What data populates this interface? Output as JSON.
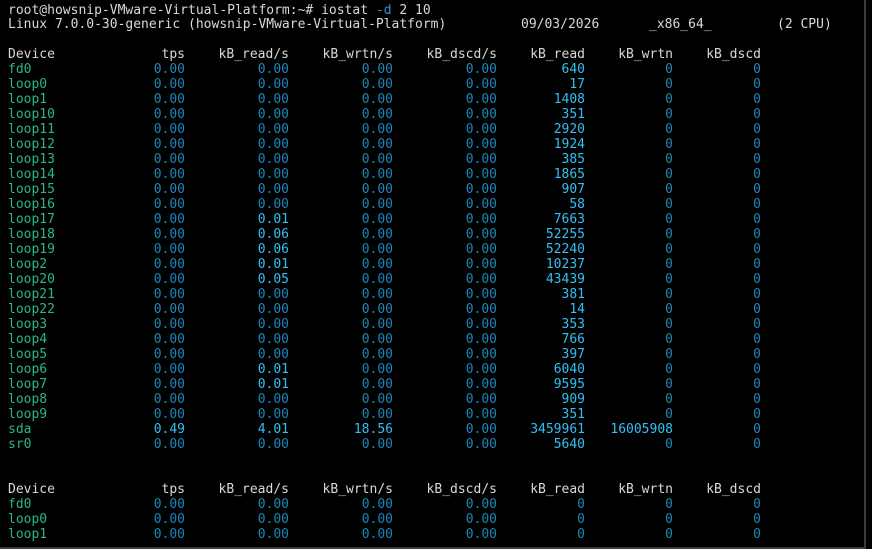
{
  "prompt": {
    "user_host": "root@howsnip-VMware-Virtual-Platform:~#",
    "command": "iostat",
    "flag": "-d",
    "args": "2 10"
  },
  "sysinfo": {
    "kernel": "Linux 7.0.0-30-generic (howsnip-VMware-Virtual-Platform)",
    "date": "09/03/2026",
    "arch": "_x86_64_",
    "cpus": "(2 CPU)"
  },
  "columns": [
    "Device",
    "tps",
    "kB_read/s",
    "kB_wrtn/s",
    "kB_dscd/s",
    "kB_read",
    "kB_wrtn",
    "kB_dscd"
  ],
  "report1": [
    [
      "fd0",
      "0.00",
      "0.00",
      "0.00",
      "0.00",
      "640",
      "0",
      "0"
    ],
    [
      "loop0",
      "0.00",
      "0.00",
      "0.00",
      "0.00",
      "17",
      "0",
      "0"
    ],
    [
      "loop1",
      "0.00",
      "0.00",
      "0.00",
      "0.00",
      "1408",
      "0",
      "0"
    ],
    [
      "loop10",
      "0.00",
      "0.00",
      "0.00",
      "0.00",
      "351",
      "0",
      "0"
    ],
    [
      "loop11",
      "0.00",
      "0.00",
      "0.00",
      "0.00",
      "2920",
      "0",
      "0"
    ],
    [
      "loop12",
      "0.00",
      "0.00",
      "0.00",
      "0.00",
      "1924",
      "0",
      "0"
    ],
    [
      "loop13",
      "0.00",
      "0.00",
      "0.00",
      "0.00",
      "385",
      "0",
      "0"
    ],
    [
      "loop14",
      "0.00",
      "0.00",
      "0.00",
      "0.00",
      "1865",
      "0",
      "0"
    ],
    [
      "loop15",
      "0.00",
      "0.00",
      "0.00",
      "0.00",
      "907",
      "0",
      "0"
    ],
    [
      "loop16",
      "0.00",
      "0.00",
      "0.00",
      "0.00",
      "58",
      "0",
      "0"
    ],
    [
      "loop17",
      "0.00",
      "0.01",
      "0.00",
      "0.00",
      "7663",
      "0",
      "0"
    ],
    [
      "loop18",
      "0.00",
      "0.06",
      "0.00",
      "0.00",
      "52255",
      "0",
      "0"
    ],
    [
      "loop19",
      "0.00",
      "0.06",
      "0.00",
      "0.00",
      "52240",
      "0",
      "0"
    ],
    [
      "loop2",
      "0.00",
      "0.01",
      "0.00",
      "0.00",
      "10237",
      "0",
      "0"
    ],
    [
      "loop20",
      "0.00",
      "0.05",
      "0.00",
      "0.00",
      "43439",
      "0",
      "0"
    ],
    [
      "loop21",
      "0.00",
      "0.00",
      "0.00",
      "0.00",
      "381",
      "0",
      "0"
    ],
    [
      "loop22",
      "0.00",
      "0.00",
      "0.00",
      "0.00",
      "14",
      "0",
      "0"
    ],
    [
      "loop3",
      "0.00",
      "0.00",
      "0.00",
      "0.00",
      "353",
      "0",
      "0"
    ],
    [
      "loop4",
      "0.00",
      "0.00",
      "0.00",
      "0.00",
      "766",
      "0",
      "0"
    ],
    [
      "loop5",
      "0.00",
      "0.00",
      "0.00",
      "0.00",
      "397",
      "0",
      "0"
    ],
    [
      "loop6",
      "0.00",
      "0.01",
      "0.00",
      "0.00",
      "6040",
      "0",
      "0"
    ],
    [
      "loop7",
      "0.00",
      "0.01",
      "0.00",
      "0.00",
      "9595",
      "0",
      "0"
    ],
    [
      "loop8",
      "0.00",
      "0.00",
      "0.00",
      "0.00",
      "909",
      "0",
      "0"
    ],
    [
      "loop9",
      "0.00",
      "0.00",
      "0.00",
      "0.00",
      "351",
      "0",
      "0"
    ],
    [
      "sda",
      "0.49",
      "4.01",
      "18.56",
      "0.00",
      "3459961",
      "16005908",
      "0"
    ],
    [
      "sr0",
      "0.00",
      "0.00",
      "0.00",
      "0.00",
      "5640",
      "0",
      "0"
    ]
  ],
  "report2": [
    [
      "fd0",
      "0.00",
      "0.00",
      "0.00",
      "0.00",
      "0",
      "0",
      "0"
    ],
    [
      "loop0",
      "0.00",
      "0.00",
      "0.00",
      "0.00",
      "0",
      "0",
      "0"
    ],
    [
      "loop1",
      "0.00",
      "0.00",
      "0.00",
      "0.00",
      "0",
      "0",
      "0"
    ]
  ],
  "colors": {
    "background": "#000000",
    "device": "#2ab58a",
    "zero_value": "#1b87b6",
    "nonzero_value": "#31c0f2",
    "header_text": "#d8d8d8"
  }
}
